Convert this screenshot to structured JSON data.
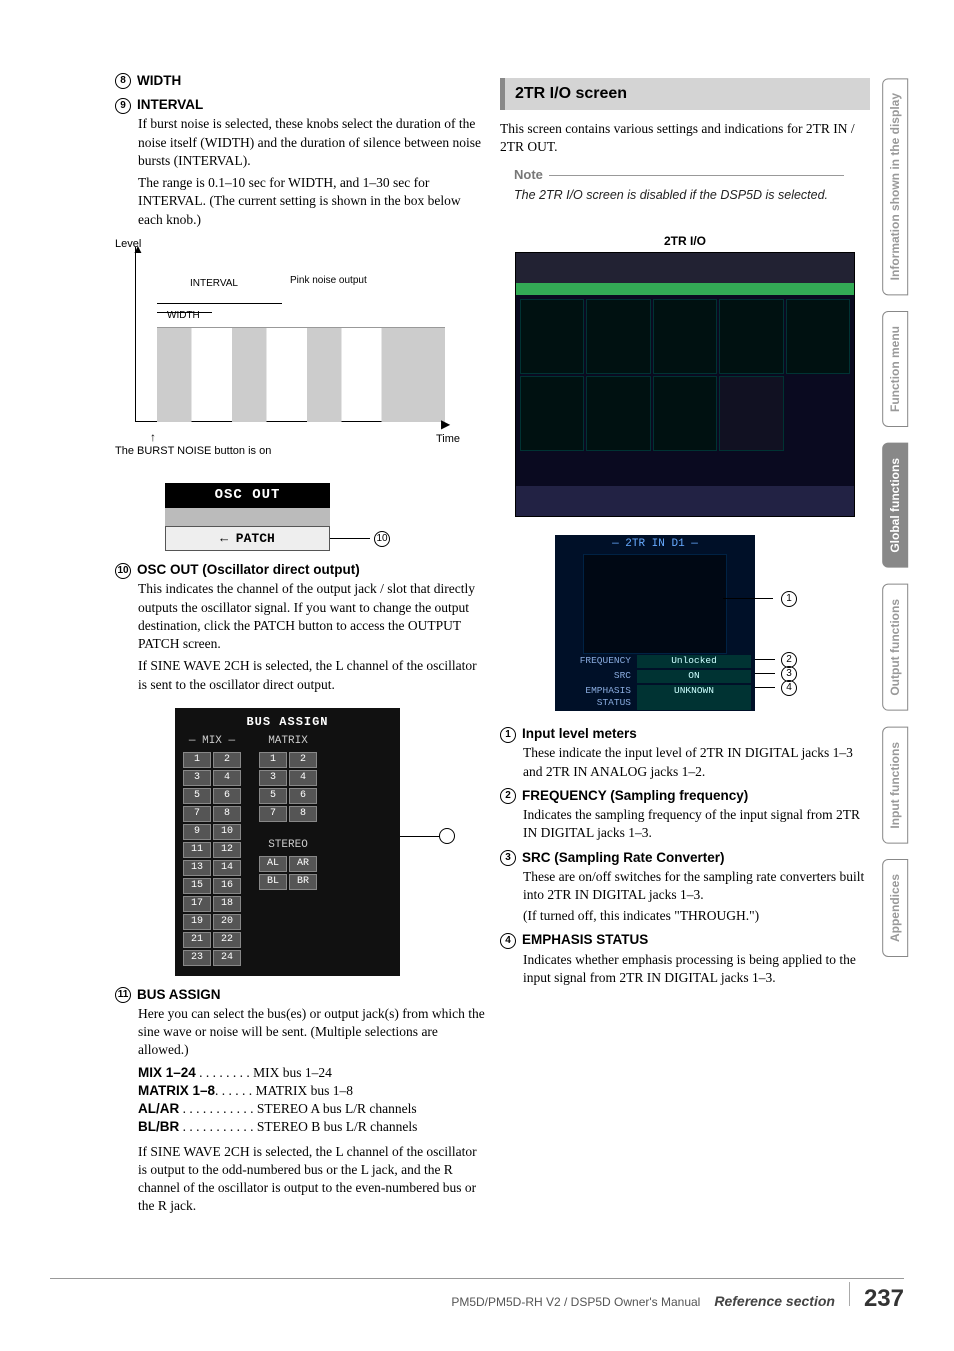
{
  "left": {
    "width": {
      "num": "8",
      "title": "WIDTH"
    },
    "interval": {
      "num": "9",
      "title": "INTERVAL",
      "p1": "If burst noise is selected, these knobs select the duration of the noise itself (WIDTH) and the duration of silence between noise bursts (INTERVAL).",
      "p2": "The range is 0.1–10 sec for WIDTH, and 1–30 sec for INTERVAL. (The current setting is shown in the box below each knob.)"
    },
    "graph": {
      "level": "Level",
      "time": "Time",
      "interval": "INTERVAL",
      "width": "WIDTH",
      "pink": "Pink noise output",
      "caption": "The BURST NOISE button is on"
    },
    "osc_out_box": {
      "head": "OSC OUT",
      "patch": "← PATCH"
    },
    "osc_out": {
      "num": "10",
      "title": "OSC OUT (Oscillator direct output)",
      "p1": "This indicates the channel of the output jack / slot that directly outputs the oscillator signal. If you want to change the output destination, click the PATCH button to access the OUTPUT PATCH screen.",
      "p2": "If SINE WAVE 2CH is selected, the L channel of the oscillator is sent to the oscillator direct output."
    },
    "bus_assign_box": {
      "title": "BUS ASSIGN",
      "mix_label": "— MIX —",
      "matrix_label": "MATRIX",
      "stereo_label": "STEREO",
      "mix_numbers": [
        "1",
        "2",
        "3",
        "4",
        "5",
        "6",
        "7",
        "8",
        "9",
        "10",
        "11",
        "12",
        "13",
        "14",
        "15",
        "16",
        "17",
        "18",
        "19",
        "20",
        "21",
        "22",
        "23",
        "24"
      ],
      "matrix_numbers": [
        "1",
        "2",
        "3",
        "4",
        "5",
        "6",
        "7",
        "8"
      ],
      "stereo_cells": [
        "AL",
        "AR",
        "BL",
        "BR"
      ]
    },
    "bus_assign": {
      "num": "11",
      "title": "BUS ASSIGN",
      "p1": "Here you can select the bus(es) or output jack(s) from which the sine wave or noise will be sent. (Multiple selections are allowed.)",
      "rows": [
        {
          "k": "MIX 1–24",
          "dots": " . . . . . . . . ",
          "v": "MIX bus 1–24"
        },
        {
          "k": "MATRIX 1–8",
          "dots": ". . . . . . ",
          "v": "MATRIX bus 1–8"
        },
        {
          "k": "AL/AR",
          "dots": " . . . . . . . . . . . ",
          "v": "STEREO A bus L/R channels"
        },
        {
          "k": "BL/BR",
          "dots": " . . . . . . . . . . . ",
          "v": "STEREO B bus L/R channels"
        }
      ],
      "p2": "If SINE WAVE 2CH is selected, the L channel of the oscillator is output to the odd-numbered bus or the L jack, and the R channel of the oscillator is output to the even-numbered bus or the R jack."
    }
  },
  "right": {
    "section_title": "2TR I/O screen",
    "intro": "This screen contains various settings and indications for 2TR IN / 2TR OUT.",
    "note_title": "Note",
    "note_body": "The 2TR I/O screen is disabled if the DSP5D is selected.",
    "ss_label": "2TR I/O",
    "fm": {
      "head": "— 2TR IN D1 —",
      "rows": [
        {
          "k": "FREQUENCY",
          "v": "Unlocked"
        },
        {
          "k": "SRC",
          "v": "ON"
        },
        {
          "k": "EMPHASIS STATUS",
          "v": "UNKNOWN"
        }
      ]
    },
    "items": [
      {
        "num": "1",
        "title": "Input level meters",
        "body": "These indicate the input level of 2TR IN DIGITAL jacks 1–3 and 2TR IN ANALOG jacks 1–2."
      },
      {
        "num": "2",
        "title": "FREQUENCY (Sampling frequency)",
        "body": "Indicates the sampling frequency of the input signal from 2TR IN DIGITAL jacks 1–3."
      },
      {
        "num": "3",
        "title": "SRC (Sampling Rate Converter)",
        "body": "These are on/off switches for the sampling rate converters built into 2TR IN DIGITAL jacks 1–3.",
        "body2": "(If turned off, this indicates \"THROUGH.\")"
      },
      {
        "num": "4",
        "title": "EMPHASIS STATUS",
        "body": "Indicates whether emphasis processing is being applied to the input signal from 2TR IN DIGITAL jacks 1–3."
      }
    ]
  },
  "tabs": [
    {
      "label": "Information shown in the display",
      "active": false
    },
    {
      "label": "Function menu",
      "active": false
    },
    {
      "label": "Global functions",
      "active": true
    },
    {
      "label": "Output functions",
      "active": false
    },
    {
      "label": "Input functions",
      "active": false
    },
    {
      "label": "Appendices",
      "active": false
    }
  ],
  "footer": {
    "manual": "PM5D/PM5D-RH V2 / DSP5D Owner's Manual",
    "ref": "Reference section",
    "page": "237"
  }
}
